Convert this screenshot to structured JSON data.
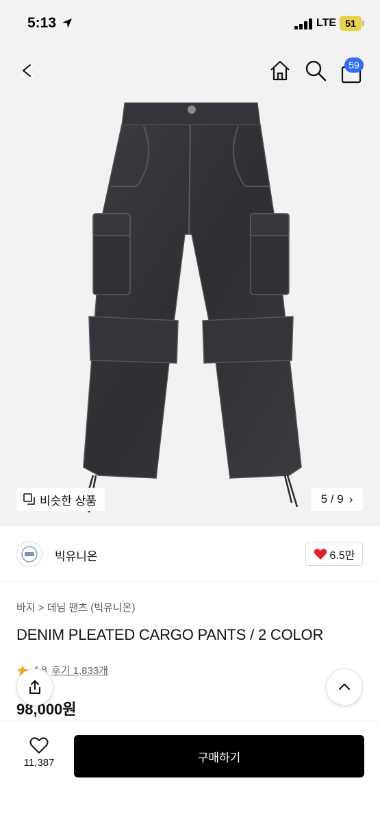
{
  "status_bar": {
    "time": "5:13",
    "network": "LTE",
    "battery": "51",
    "battery_color": "#e8d24a"
  },
  "top_bar": {
    "icons": [
      "close-icon",
      "home-icon",
      "search-icon",
      "shopping-bag-icon"
    ],
    "cart_badge": "59",
    "badge_color": "#2f6df6"
  },
  "gallery": {
    "similar_label": "비슷한 상품",
    "page_counter": "5 / 9",
    "current_page": 5,
    "total_pages": 9
  },
  "brand": {
    "name": "빅유니온",
    "likes": "6.5만",
    "heart_color": "#e0202a"
  },
  "product": {
    "breadcrumb_category": "바지",
    "breadcrumb_separator": ">",
    "breadcrumb_sub": "데님 팬츠 (빅유니온)",
    "title": "DENIM PLEATED CARGO PANTS / 2 COLOR",
    "rating": "4.8",
    "reviews": "후기 1,833개",
    "price": "98,000원",
    "star_color": "#f5a623"
  },
  "bottom_bar": {
    "wish_count": "11,387",
    "buy_label": "구매하기"
  }
}
